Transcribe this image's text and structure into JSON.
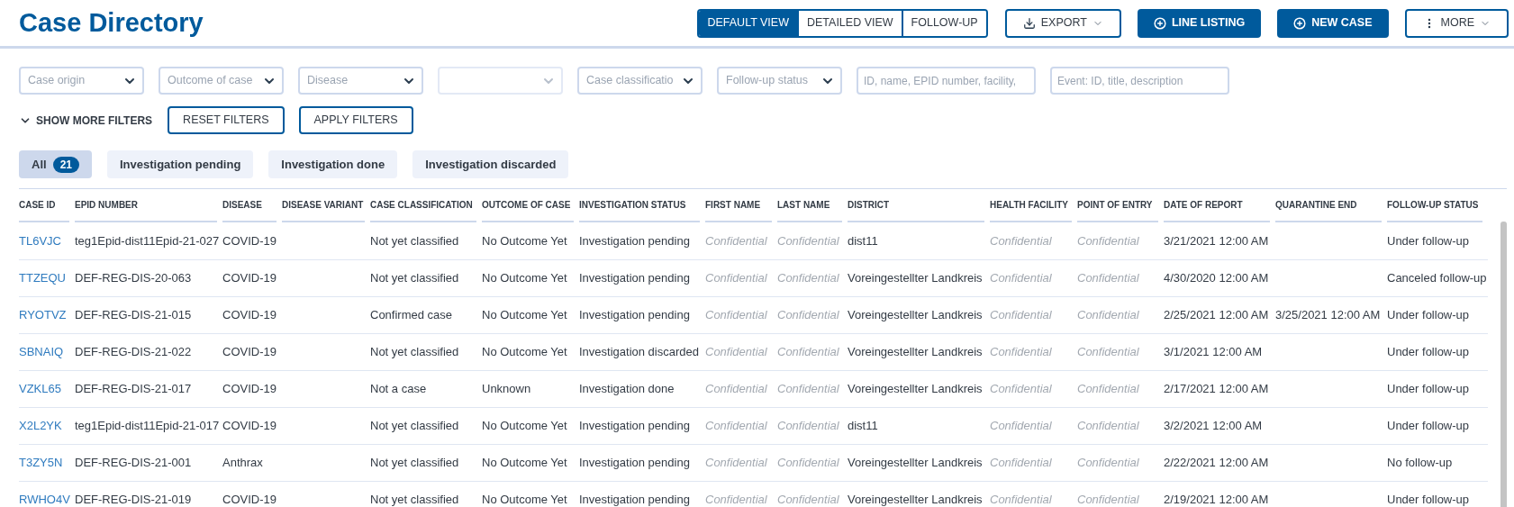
{
  "page_title": "Case Directory",
  "view_toggle": [
    {
      "label": "DEFAULT VIEW",
      "selected": true
    },
    {
      "label": "DETAILED VIEW",
      "selected": false
    },
    {
      "label": "FOLLOW-UP",
      "selected": false
    }
  ],
  "actions": [
    {
      "label": "EXPORT",
      "kind": "export",
      "caret": true
    },
    {
      "label": "LINE LISTING",
      "kind": "create",
      "caret": false
    },
    {
      "label": "NEW CASE",
      "kind": "create",
      "caret": false
    },
    {
      "label": "MORE",
      "kind": "more",
      "caret": true
    }
  ],
  "filters": [
    {
      "kind": "select",
      "placeholder": "Case origin",
      "disabled": false
    },
    {
      "kind": "select",
      "placeholder": "Outcome of case",
      "disabled": false
    },
    {
      "kind": "select",
      "placeholder": "Disease",
      "disabled": false
    },
    {
      "kind": "select",
      "disabled": true
    },
    {
      "kind": "select",
      "placeholder": "Case classificatio",
      "disabled": false
    },
    {
      "kind": "select",
      "placeholder": "Follow-up status",
      "disabled": false
    },
    {
      "kind": "text",
      "placeholder": "ID, name, EPID number, facility,",
      "disabled": false
    },
    {
      "kind": "text",
      "placeholder": "Event: ID, title, description",
      "disabled": false
    }
  ],
  "show_more_filters": "SHOW MORE FILTERS",
  "filter_buttons": [
    "RESET FILTERS",
    "APPLY FILTERS"
  ],
  "status_tabs": [
    {
      "label": "All",
      "count": "21",
      "selected": true
    },
    {
      "label": "Investigation pending",
      "selected": false
    },
    {
      "label": "Investigation done",
      "selected": false
    },
    {
      "label": "Investigation discarded",
      "selected": false
    }
  ],
  "table": {
    "columns": [
      {
        "label": "CASE ID",
        "kind": "link"
      },
      {
        "label": "EPID NUMBER",
        "kind": "text"
      },
      {
        "label": "DISEASE",
        "kind": "text"
      },
      {
        "label": "DISEASE VARIANT",
        "kind": "text"
      },
      {
        "label": "CASE CLASSIFICATION",
        "kind": "text"
      },
      {
        "label": "OUTCOME OF CASE",
        "kind": "text"
      },
      {
        "label": "INVESTIGATION STATUS",
        "kind": "text"
      },
      {
        "label": "FIRST NAME",
        "kind": "masked"
      },
      {
        "label": "LAST NAME",
        "kind": "masked"
      },
      {
        "label": "DISTRICT",
        "kind": "text"
      },
      {
        "label": "HEALTH FACILITY",
        "kind": "masked"
      },
      {
        "label": "POINT OF ENTRY",
        "kind": "masked"
      },
      {
        "label": "DATE OF REPORT",
        "kind": "text"
      },
      {
        "label": "QUARANTINE END",
        "kind": "text"
      },
      {
        "label": "FOLLOW-UP STATUS",
        "kind": "text"
      }
    ],
    "rows": [
      [
        "TL6VJC",
        "teg1Epid-dist11Epid-21-027",
        "COVID-19",
        null,
        "Not yet classified",
        "No Outcome Yet",
        "Investigation pending",
        "Confidential",
        "Confidential",
        "dist11",
        "Confidential",
        "Confidential",
        "3/21/2021 12:00 AM",
        null,
        "Under follow-up"
      ],
      [
        "TTZEQU",
        "DEF-REG-DIS-20-063",
        "COVID-19",
        null,
        "Not yet classified",
        "No Outcome Yet",
        "Investigation pending",
        "Confidential",
        "Confidential",
        "Voreingestellter Landkreis",
        "Confidential",
        "Confidential",
        "4/30/2020 12:00 AM",
        null,
        "Canceled follow-up"
      ],
      [
        "RYOTVZ",
        "DEF-REG-DIS-21-015",
        "COVID-19",
        null,
        "Confirmed case",
        "No Outcome Yet",
        "Investigation pending",
        "Confidential",
        "Confidential",
        "Voreingestellter Landkreis",
        "Confidential",
        "Confidential",
        "2/25/2021 12:00 AM",
        "3/25/2021 12:00 AM",
        "Under follow-up"
      ],
      [
        "SBNAIQ",
        "DEF-REG-DIS-21-022",
        "COVID-19",
        null,
        "Not yet classified",
        "No Outcome Yet",
        "Investigation discarded",
        "Confidential",
        "Confidential",
        "Voreingestellter Landkreis",
        "Confidential",
        "Confidential",
        "3/1/2021 12:00 AM",
        null,
        "Under follow-up"
      ],
      [
        "VZKL65",
        "DEF-REG-DIS-21-017",
        "COVID-19",
        null,
        "Not a case",
        "Unknown",
        "Investigation done",
        "Confidential",
        "Confidential",
        "Voreingestellter Landkreis",
        "Confidential",
        "Confidential",
        "2/17/2021 12:00 AM",
        null,
        "Under follow-up"
      ],
      [
        "X2L2YK",
        "teg1Epid-dist11Epid-21-017",
        "COVID-19",
        null,
        "Not yet classified",
        "No Outcome Yet",
        "Investigation pending",
        "Confidential",
        "Confidential",
        "dist11",
        "Confidential",
        "Confidential",
        "3/2/2021 12:00 AM",
        null,
        "Under follow-up"
      ],
      [
        "T3ZY5N",
        "DEF-REG-DIS-21-001",
        "Anthrax",
        null,
        "Not yet classified",
        "No Outcome Yet",
        "Investigation pending",
        "Confidential",
        "Confidential",
        "Voreingestellter Landkreis",
        "Confidential",
        "Confidential",
        "2/22/2021 12:00 AM",
        null,
        "No follow-up"
      ],
      [
        "RWHO4V",
        "DEF-REG-DIS-21-019",
        "COVID-19",
        null,
        "Not yet classified",
        "No Outcome Yet",
        "Investigation pending",
        "Confidential",
        "Confidential",
        "Voreingestellter Landkreis",
        "Confidential",
        "Confidential",
        "2/19/2021 12:00 AM",
        null,
        "Under follow-up"
      ]
    ]
  }
}
